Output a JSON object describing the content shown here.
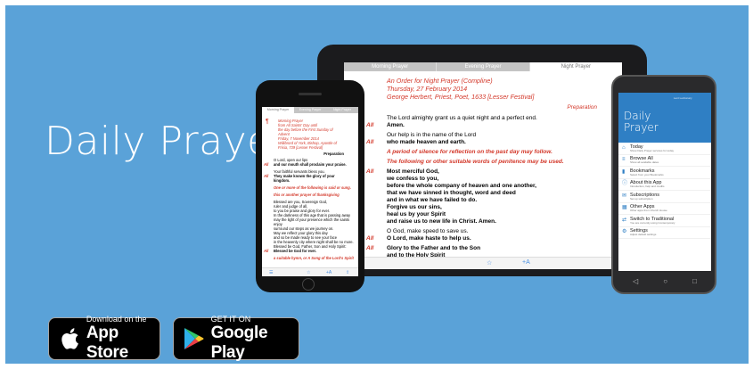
{
  "app_name": "Daily Prayer",
  "badges": {
    "apple": {
      "small": "Download on the",
      "big": "App Store"
    },
    "google": {
      "small": "GET IT ON",
      "big": "Google Play"
    }
  },
  "tablet": {
    "tabs": [
      "Morning Prayer",
      "Evening Prayer",
      "Night Prayer"
    ],
    "active_tab": "Night Prayer",
    "heading": [
      "An Order for Night Prayer (Compline)",
      "Thursday, 27 February 2014",
      "George Herbert, Priest, Poet, 1633 [Lesser Festival]"
    ],
    "section": "Preparation",
    "lines": [
      {
        "r": "",
        "t": "The Lord almighty grant us a quiet night and a perfect end.",
        "s": "n"
      },
      {
        "r": "All",
        "t": "Amen.",
        "s": "b"
      },
      {
        "r": "",
        "t": "Our help is in the name of the Lord",
        "s": "n"
      },
      {
        "r": "All",
        "t": "who made heaven and earth.",
        "s": "b"
      },
      {
        "r": "",
        "t": "A period of silence for reflection on the past day may follow.",
        "s": "ri"
      },
      {
        "r": "",
        "t": "The following or other suitable words of penitence may be used.",
        "s": "ri"
      },
      {
        "r": "All",
        "t": "Most merciful God,",
        "s": "b"
      },
      {
        "r": "",
        "t": "we confess to you,",
        "s": "b"
      },
      {
        "r": "",
        "t": "before the whole company of heaven and one another,",
        "s": "b"
      },
      {
        "r": "",
        "t": "that we have sinned in thought, word and deed",
        "s": "b"
      },
      {
        "r": "",
        "t": "and in what we have failed to do.",
        "s": "b"
      },
      {
        "r": "",
        "t": "Forgive us our sins,",
        "s": "b"
      },
      {
        "r": "",
        "t": "heal us by your Spirit",
        "s": "b"
      },
      {
        "r": "",
        "t": "and raise us to new life in Christ. Amen.",
        "s": "b"
      },
      {
        "r": "",
        "t": "O God, make speed to save us.",
        "s": "n"
      },
      {
        "r": "All",
        "t": "O Lord, make haste to help us.",
        "s": "b"
      },
      {
        "r": "All",
        "t": "Glory to the Father and to the Son",
        "s": "b"
      },
      {
        "r": "",
        "t": "and to the Holy Spirit",
        "s": "b"
      }
    ]
  },
  "iphone": {
    "tabs": [
      "Morning Prayer",
      "Evening Prayer",
      "Night Prayer"
    ],
    "heading": [
      "Morning Prayer",
      "from All Saints' Day until",
      "the day before the First Sunday of",
      "Advent",
      "Friday, 7 November 2014",
      "Willibrord of York, Bishop, Apostle of",
      "Frisia, 739 [Lesser Festival]"
    ],
    "section": "Preparation",
    "lines": [
      {
        "r": "",
        "t": "O Lord, open our lips",
        "s": "n"
      },
      {
        "r": "All",
        "t": "and our mouth shall proclaim your praise.",
        "s": "b"
      },
      {
        "r": "",
        "t": "Your faithful servants bless you.",
        "s": "n"
      },
      {
        "r": "All",
        "t": "They make known the glory of your",
        "s": "b"
      },
      {
        "r": "",
        "t": "kingdom.",
        "s": "b"
      },
      {
        "r": "",
        "t": "One or more of the following is said or sung.",
        "s": "ri"
      },
      {
        "r": "",
        "t": "this or another prayer of thanksgiving",
        "s": "ri"
      },
      {
        "r": "",
        "t": "Blessed are you, Sovereign God,",
        "s": "n"
      },
      {
        "r": "",
        "t": "ruler and judge of all,",
        "s": "n"
      },
      {
        "r": "",
        "t": "to you be praise and glory for ever.",
        "s": "n"
      },
      {
        "r": "",
        "t": "In the darkness of this age that is passing away",
        "s": "n"
      },
      {
        "r": "",
        "t": "may the light of your presence which the saints enjoy",
        "s": "n"
      },
      {
        "r": "",
        "t": "surround our steps as we journey on.",
        "s": "n"
      },
      {
        "r": "",
        "t": "May we reflect your glory this day",
        "s": "n"
      },
      {
        "r": "",
        "t": "and so be made ready to see your face",
        "s": "n"
      },
      {
        "r": "",
        "t": "in the heavenly city where night shall be no more.",
        "s": "n"
      },
      {
        "r": "",
        "t": "Blessed be God, Father, Son and Holy Spirit:",
        "s": "n"
      },
      {
        "r": "All",
        "t": "Blessed be God for ever.",
        "s": "b"
      },
      {
        "r": "",
        "t": "a suitable hymn, or A Song of the Lord's Spirit",
        "s": "ri"
      }
    ]
  },
  "android": {
    "header_small": "Lent Lectionary",
    "app_title_line1": "Daily",
    "app_title_line2": "Prayer",
    "menu": [
      {
        "label": "Today",
        "sub": "Show Daily Prayer services for today",
        "icon": "home-icon"
      },
      {
        "label": "Browse All",
        "sub": "Show all available dates",
        "icon": "list-icon"
      },
      {
        "label": "Bookmarks",
        "sub": "Select from your Bookmarks",
        "icon": "bookmark-icon"
      },
      {
        "label": "About this App",
        "sub": "Introduction, help and credits",
        "icon": "info-icon"
      },
      {
        "label": "Subscriptions",
        "sub": "Set up subscription",
        "icon": "subscription-icon"
      },
      {
        "label": "Other Apps",
        "sub": "Other apps from Church House",
        "icon": "apps-icon"
      },
      {
        "label": "Switch to Traditional",
        "sub": "You are currently using Contemporary",
        "icon": "switch-icon"
      },
      {
        "label": "Settings",
        "sub": "Adjust default settings",
        "icon": "settings-icon"
      }
    ]
  },
  "colors": {
    "background": "#5aa2d8",
    "accent_red": "#d3382a",
    "android_blue": "#2f7fc4"
  }
}
